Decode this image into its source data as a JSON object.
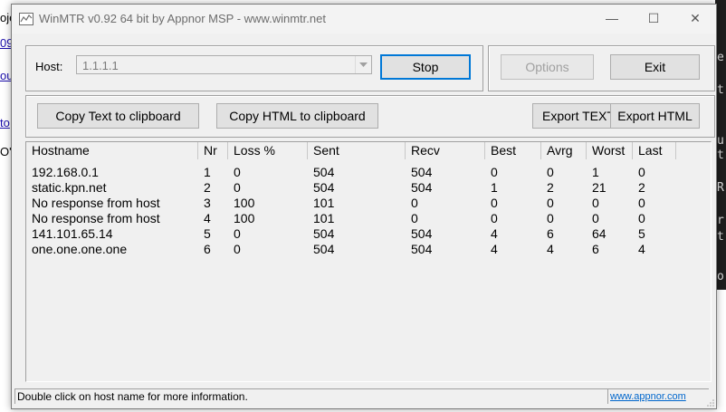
{
  "background": {
    "left_fragments": [
      "oje",
      "09",
      "ous",
      "to",
      "O'"
    ],
    "right_fragments": [
      "e",
      "t",
      "u",
      "t",
      "R",
      "r",
      "t",
      "o"
    ]
  },
  "window": {
    "title": "WinMTR v0.92 64 bit by Appnor MSP - www.winmtr.net",
    "minimize_glyph": "—",
    "maximize_glyph": "☐",
    "close_glyph": "✕"
  },
  "host": {
    "label": "Host:",
    "value": "1.1.1.1"
  },
  "buttons": {
    "stop": "Stop",
    "options": "Options",
    "exit": "Exit",
    "copy_text": "Copy Text to clipboard",
    "copy_html": "Copy HTML to clipboard",
    "export_text": "Export TEXT",
    "export_html": "Export HTML"
  },
  "table": {
    "columns": [
      "Hostname",
      "Nr",
      "Loss %",
      "Sent",
      "Recv",
      "Best",
      "Avrg",
      "Worst",
      "Last"
    ],
    "rows": [
      [
        "192.168.0.1",
        "1",
        "0",
        "504",
        "504",
        "0",
        "0",
        "1",
        "0"
      ],
      [
        "static.kpn.net",
        "2",
        "0",
        "504",
        "504",
        "1",
        "2",
        "21",
        "2"
      ],
      [
        "No response from host",
        "3",
        "100",
        "101",
        "0",
        "0",
        "0",
        "0",
        "0"
      ],
      [
        "No response from host",
        "4",
        "100",
        "101",
        "0",
        "0",
        "0",
        "0",
        "0"
      ],
      [
        "141.101.65.14",
        "5",
        "0",
        "504",
        "504",
        "4",
        "6",
        "64",
        "5"
      ],
      [
        "one.one.one.one",
        "6",
        "0",
        "504",
        "504",
        "4",
        "4",
        "6",
        "4"
      ]
    ]
  },
  "status": {
    "text": "Double click on host name for more information.",
    "link": "www.appnor.com"
  },
  "colors": {
    "window_bg": "#f0f0f0",
    "focus_border": "#0078d7",
    "link": "#0066cc"
  }
}
